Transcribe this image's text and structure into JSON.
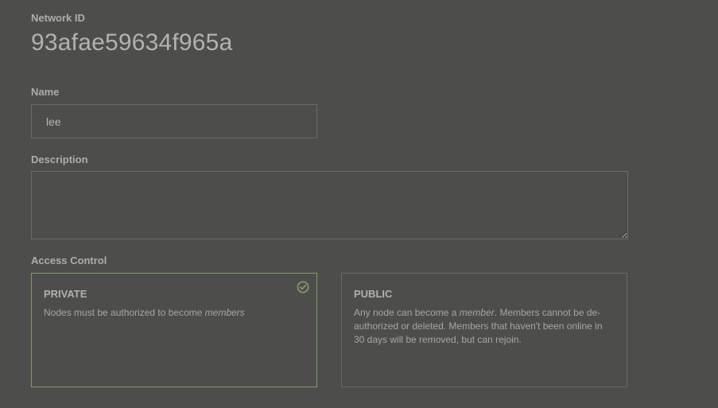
{
  "network": {
    "label": "Network ID",
    "id": "93afae59634f965a"
  },
  "name": {
    "label": "Name",
    "value": "lee"
  },
  "description": {
    "label": "Description",
    "value": ""
  },
  "access_control": {
    "label": "Access Control",
    "selected": "private",
    "private": {
      "title": "PRIVATE",
      "desc_before": "Nodes must be authorized to become ",
      "desc_em": "members",
      "desc_after": ""
    },
    "public": {
      "title": "PUBLIC",
      "desc_before": "Any node can become a ",
      "desc_em": "member",
      "desc_after": ". Members cannot be de-authorized or deleted. Members that haven't been online in 30 days will be removed, but can rejoin."
    },
    "check_icon": "check-circle-icon",
    "accent_color": "#7f9a6c"
  },
  "colors": {
    "background": "#4d4e4c",
    "text": "#b0b0ac",
    "border": "#6a6b68"
  }
}
